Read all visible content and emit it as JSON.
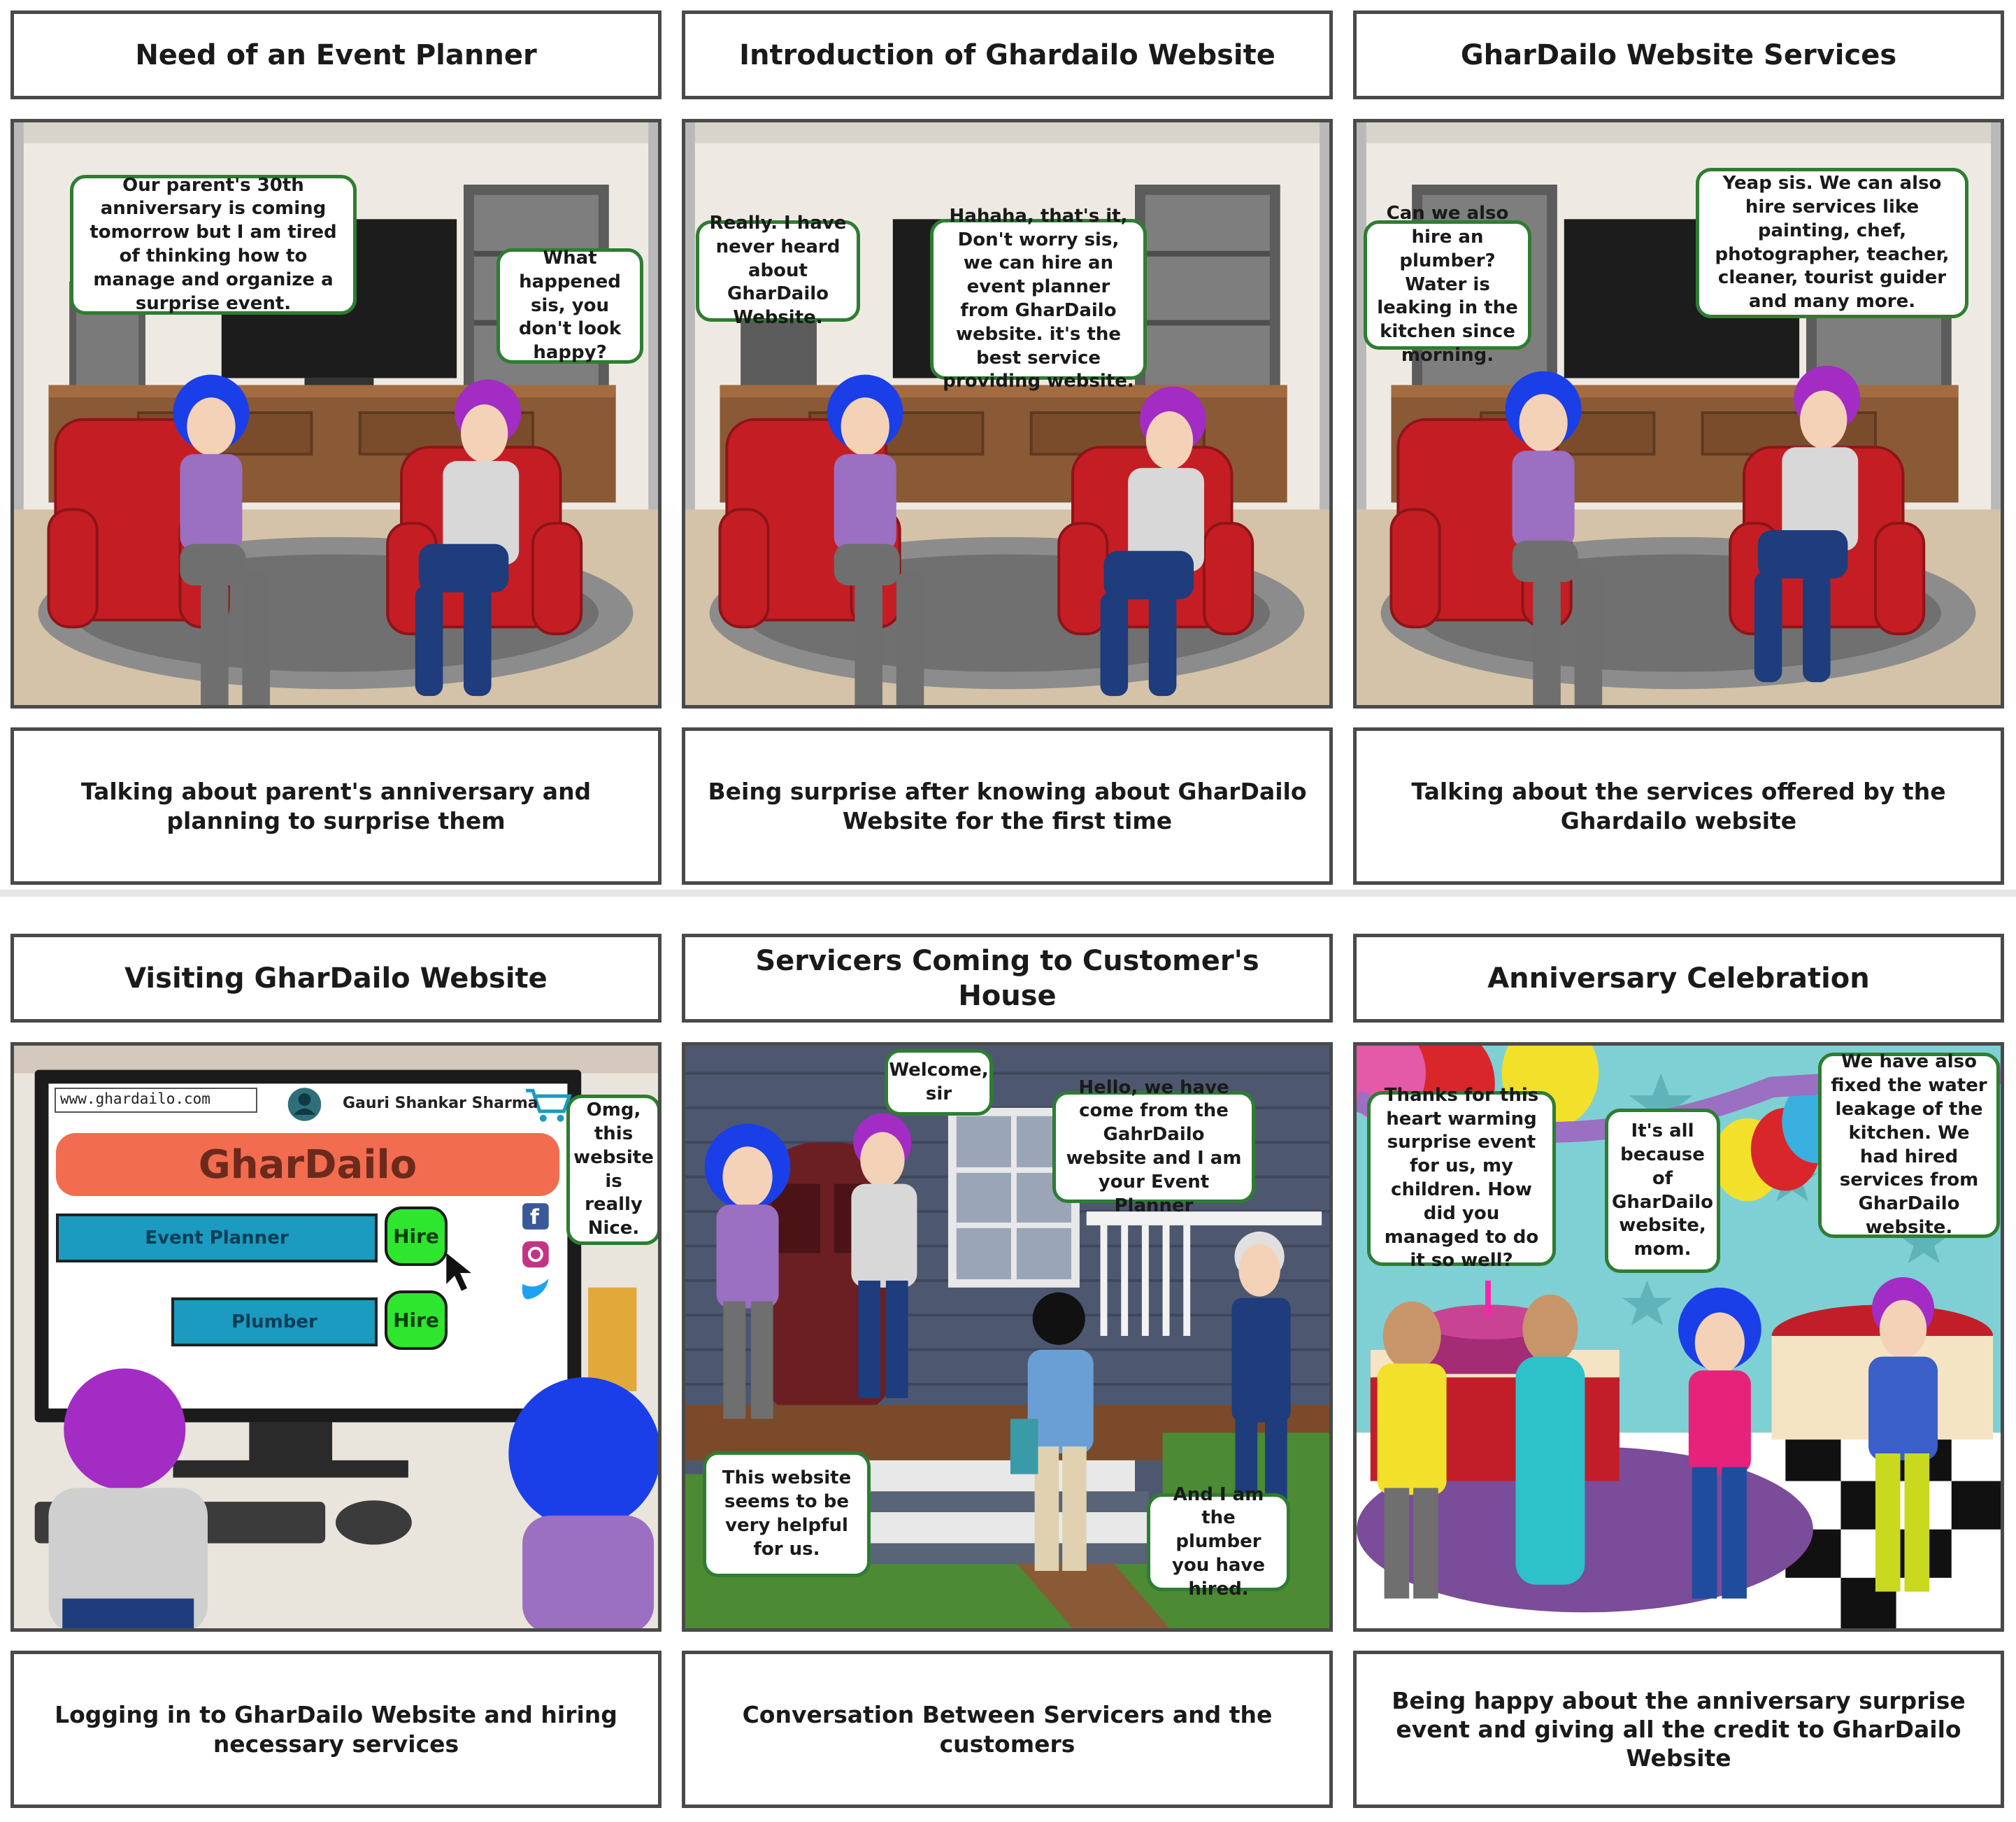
{
  "panels": [
    {
      "title": "Need of an Event Planner",
      "caption": "Talking about parent's anniversary and planning to surprise them",
      "bubbles": [
        "Our parent's 30th anniversary is coming tomorrow but I am tired of thinking how to manage and organize a surprise event.",
        "What happened sis, you don't look happy?"
      ]
    },
    {
      "title": "Introduction of Ghardailo Website",
      "caption": "Being surprise after knowing about GharDailo Website for the first time",
      "bubbles": [
        "Really. I have never heard about GharDailo Website.",
        "Hahaha, that's it, Don't worry sis, we can hire an event planner  from GharDailo website. it's the best service providing website."
      ]
    },
    {
      "title": "GharDailo Website Services",
      "caption": "Talking about the services offered by the Ghardailo website",
      "bubbles": [
        "Can we also hire an plumber? Water is leaking in the kitchen since morning.",
        "Yeap sis. We can also hire services like painting, chef, photographer, teacher, cleaner, tourist guider and many more."
      ]
    },
    {
      "title": "Visiting GharDailo Website",
      "caption": "Logging in to GharDailo Website and hiring necessary services",
      "bubbles": [
        "Omg, this website is really Nice."
      ],
      "website": {
        "url": "www.ghardailo.com",
        "user": "Gauri Shankar Sharma",
        "logo": "GharDailo",
        "services": [
          "Event Planner",
          "Plumber"
        ],
        "hire_label": "Hire",
        "icons": [
          "cart-icon",
          "user-icon",
          "facebook-icon",
          "instagram-icon",
          "twitter-icon",
          "cursor-icon"
        ]
      }
    },
    {
      "title": "Servicers Coming to Customer's House",
      "caption": "Conversation Between Servicers and the customers",
      "bubbles": [
        "Welcome, sir",
        "Hello, we have come from the GahrDailo website and I am your Event Planner",
        "This website seems to be very helpful for us.",
        "And I am the plumber you have hired."
      ]
    },
    {
      "title": "Anniversary Celebration",
      "caption": "Being happy about the anniversary surprise event and giving all the credit to GharDailo Website",
      "bubbles": [
        "Thanks for this heart warming surprise event for us, my children. How did you managed to do it so well?",
        "It's all because of GharDailo website, mom.",
        "We have also fixed the water leakage of the kitchen. We had hired services from GharDailo website."
      ]
    }
  ],
  "colors": {
    "panel_border": "#4a4a4a",
    "bubble_border": "#2e7d32",
    "sofa": "#c41e24",
    "sister_hair": "#1a3fe8",
    "brother_hair": "#a32cc4"
  }
}
